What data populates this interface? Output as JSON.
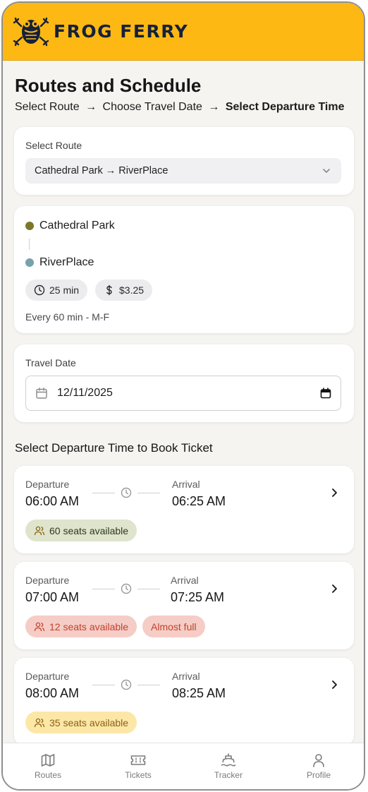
{
  "app": {
    "brand": "FROG FERRY"
  },
  "page": {
    "title": "Routes and Schedule",
    "breadcrumb": {
      "step1": "Select Route",
      "step2": "Choose Travel Date",
      "step3": "Select Departure Time",
      "separator": "→"
    }
  },
  "route_select": {
    "label": "Select Route",
    "value": "Cathedral Park → RiverPlace"
  },
  "route_info": {
    "origin": "Cathedral Park",
    "destination": "RiverPlace",
    "duration": "25 min",
    "price": "$3.25",
    "frequency": "Every 60 min - M-F",
    "colors": {
      "origin_dot": "#7d7728",
      "destination_dot": "#79a0ad"
    }
  },
  "travel_date": {
    "label": "Travel Date",
    "value": "12/11/2025"
  },
  "departures": {
    "section_title": "Select Departure Time to Book Ticket",
    "departure_label": "Departure",
    "arrival_label": "Arrival",
    "trips": [
      {
        "departure": "06:00 AM",
        "arrival": "06:25 AM",
        "seats": "60 seats available",
        "status": "available"
      },
      {
        "departure": "07:00 AM",
        "arrival": "07:25 AM",
        "seats": "12 seats available",
        "status": "low",
        "extra_badge": "Almost full"
      },
      {
        "departure": "08:00 AM",
        "arrival": "08:25 AM",
        "seats": "35 seats available",
        "status": "medium"
      }
    ],
    "status_colors": {
      "available": {
        "bg": "#dfe4cc",
        "fg": "#2f3a1b"
      },
      "low": {
        "bg": "#f5cdc6",
        "fg": "#c2412e"
      },
      "medium": {
        "bg": "#fde7a7",
        "fg": "#8a6214"
      }
    }
  },
  "nav": {
    "items": [
      {
        "label": "Routes",
        "icon": "map-icon"
      },
      {
        "label": "Tickets",
        "icon": "ticket-icon"
      },
      {
        "label": "Tracker",
        "icon": "ship-icon"
      },
      {
        "label": "Profile",
        "icon": "user-icon"
      }
    ]
  },
  "colors": {
    "header": "#fdb813",
    "brand_text": "#16213a",
    "background": "#f5f4f1"
  }
}
